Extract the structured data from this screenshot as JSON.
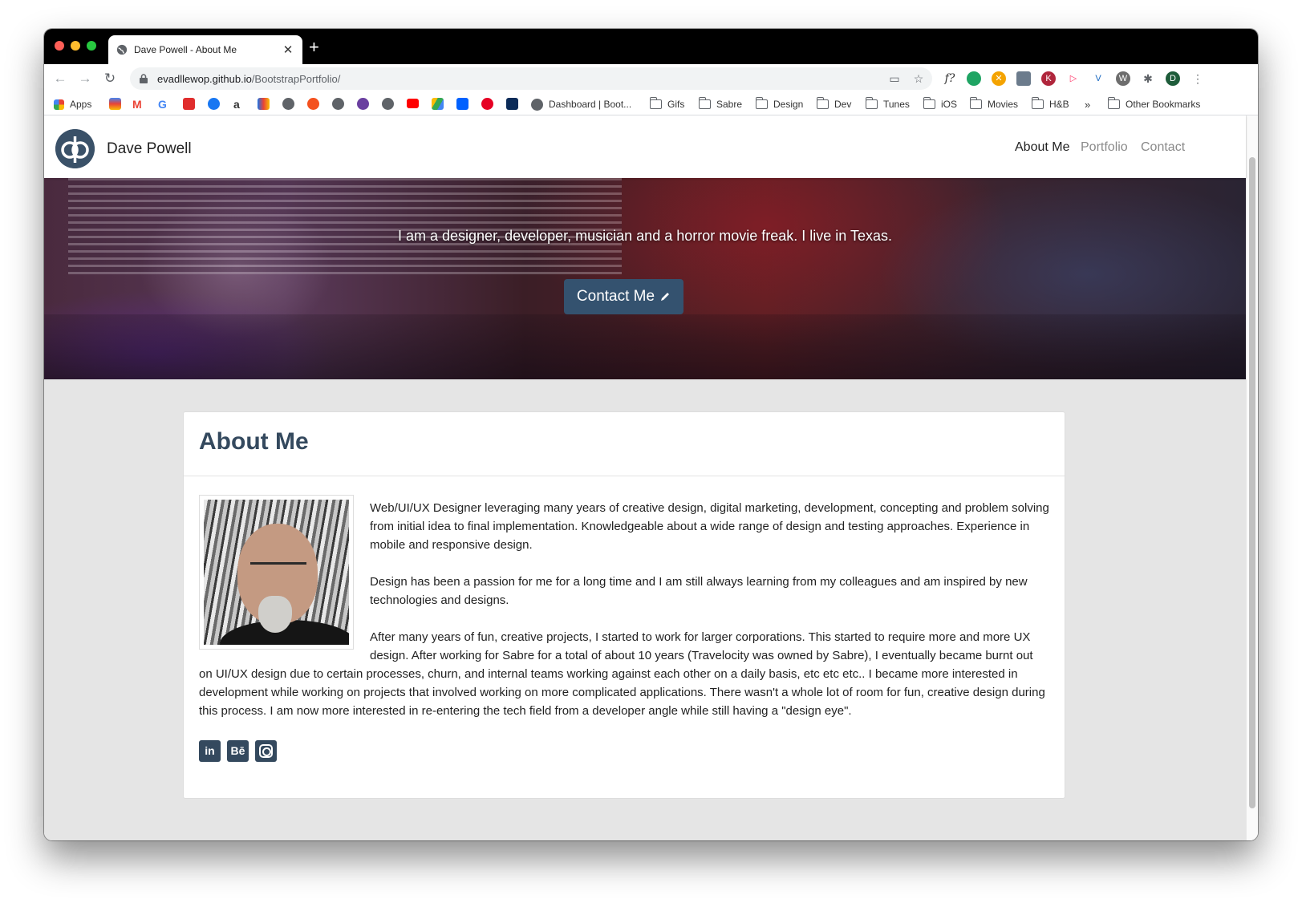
{
  "browser": {
    "tab_title": "Dave Powell - About Me",
    "tab_close": "✕",
    "new_tab": "+",
    "url_host": "evadllewop.github.io",
    "url_path": "/BootstrapPortfolio/",
    "profile_initial": "D",
    "bookmarks": {
      "apps": "Apps",
      "dashboard": "Dashboard | Boot...",
      "gifs": "Gifs",
      "sabre": "Sabre",
      "design": "Design",
      "dev": "Dev",
      "tunes": "Tunes",
      "ios": "iOS",
      "movies": "Movies",
      "hb": "H&B",
      "overflow": "»",
      "other": "Other Bookmarks"
    }
  },
  "site": {
    "brand": "Dave Powell",
    "nav": [
      "About Me",
      "Portfolio",
      "Contact"
    ],
    "hero_tagline": "I am a designer, developer, musician and a horror movie freak. I live in Texas.",
    "hero_button": "Contact Me",
    "about_title": "About Me",
    "paragraphs": [
      "Web/UI/UX Designer leveraging many years of creative design, digital marketing, development, concepting and problem solving from initial idea to final implementation. Knowledgeable about a wide range of design and testing approaches. Experience in mobile and responsive design.",
      "Design has been a passion for me for a long time and I am still always learning from my colleagues and am inspired by new technologies and designs.",
      "After many years of fun, creative projects, I started to work for larger corporations. This started to require more and more UX design. After working for Sabre for a total of about 10 years (Travelocity was owned by Sabre), I eventually became burnt out on UI/UX design due to certain processes, churn, and internal teams working against each other on a daily basis, etc etc etc.. I became more interested in development while working on projects that involved working on more complicated applications. There wasn't a whole lot of room for fun, creative design during this process. I am now more interested in re-entering the tech field from a developer angle while still having a \"design eye\"."
    ],
    "social": {
      "linkedin": "in",
      "behance": "Bē"
    }
  },
  "colors": {
    "accent": "#34495e",
    "button": "#34526f",
    "page_bg": "#e5e5e5"
  }
}
